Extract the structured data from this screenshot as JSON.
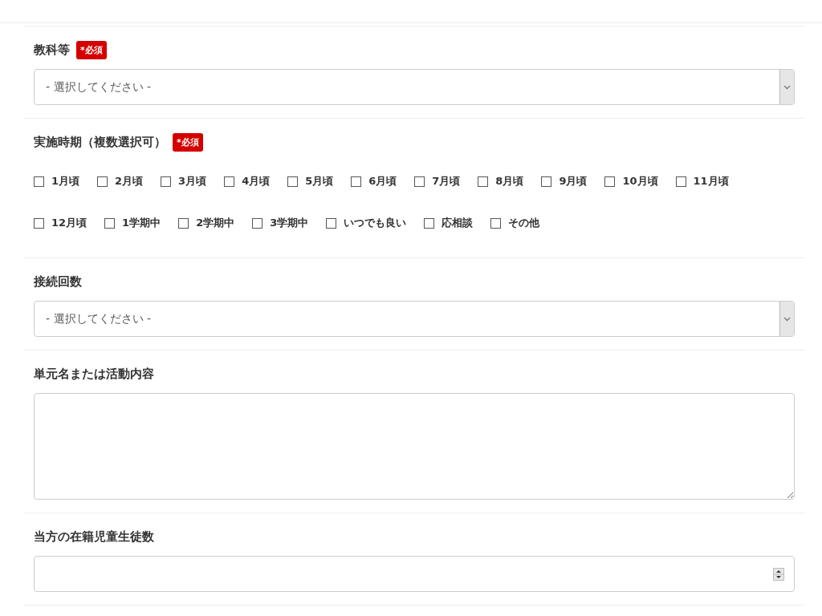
{
  "fields": [
    {
      "kind": "select",
      "label": "教科等",
      "required": true,
      "required_text": "*必須",
      "placeholder": "- 選択してください -"
    },
    {
      "kind": "checkboxes",
      "label": "実施時期（複数選択可）",
      "required": true,
      "required_text": "*必須",
      "option_rows": [
        [
          {
            "label": "1月頃",
            "checked": false
          },
          {
            "label": "2月頃",
            "checked": false
          },
          {
            "label": "3月頃",
            "checked": false
          },
          {
            "label": "4月頃",
            "checked": false
          },
          {
            "label": "5月頃",
            "checked": false
          },
          {
            "label": "6月頃",
            "checked": false
          },
          {
            "label": "7月頃",
            "checked": false
          },
          {
            "label": "8月頃",
            "checked": false
          },
          {
            "label": "9月頃",
            "checked": false
          },
          {
            "label": "10月頃",
            "checked": false
          },
          {
            "label": "11月頃",
            "checked": false
          }
        ],
        [
          {
            "label": "12月頃",
            "checked": false
          },
          {
            "label": "1学期中",
            "checked": false
          },
          {
            "label": "2学期中",
            "checked": false
          },
          {
            "label": "3学期中",
            "checked": false
          },
          {
            "label": "いつでも良い",
            "checked": false
          },
          {
            "label": "応相談",
            "checked": false
          },
          {
            "label": "その他",
            "checked": false
          }
        ]
      ]
    },
    {
      "kind": "select",
      "label": "接続回数",
      "required": false,
      "placeholder": "- 選択してください -"
    },
    {
      "kind": "textarea",
      "label": "単元名または活動内容",
      "required": false
    },
    {
      "kind": "number",
      "label": "当方の在籍児童生徒数",
      "required": false
    }
  ]
}
